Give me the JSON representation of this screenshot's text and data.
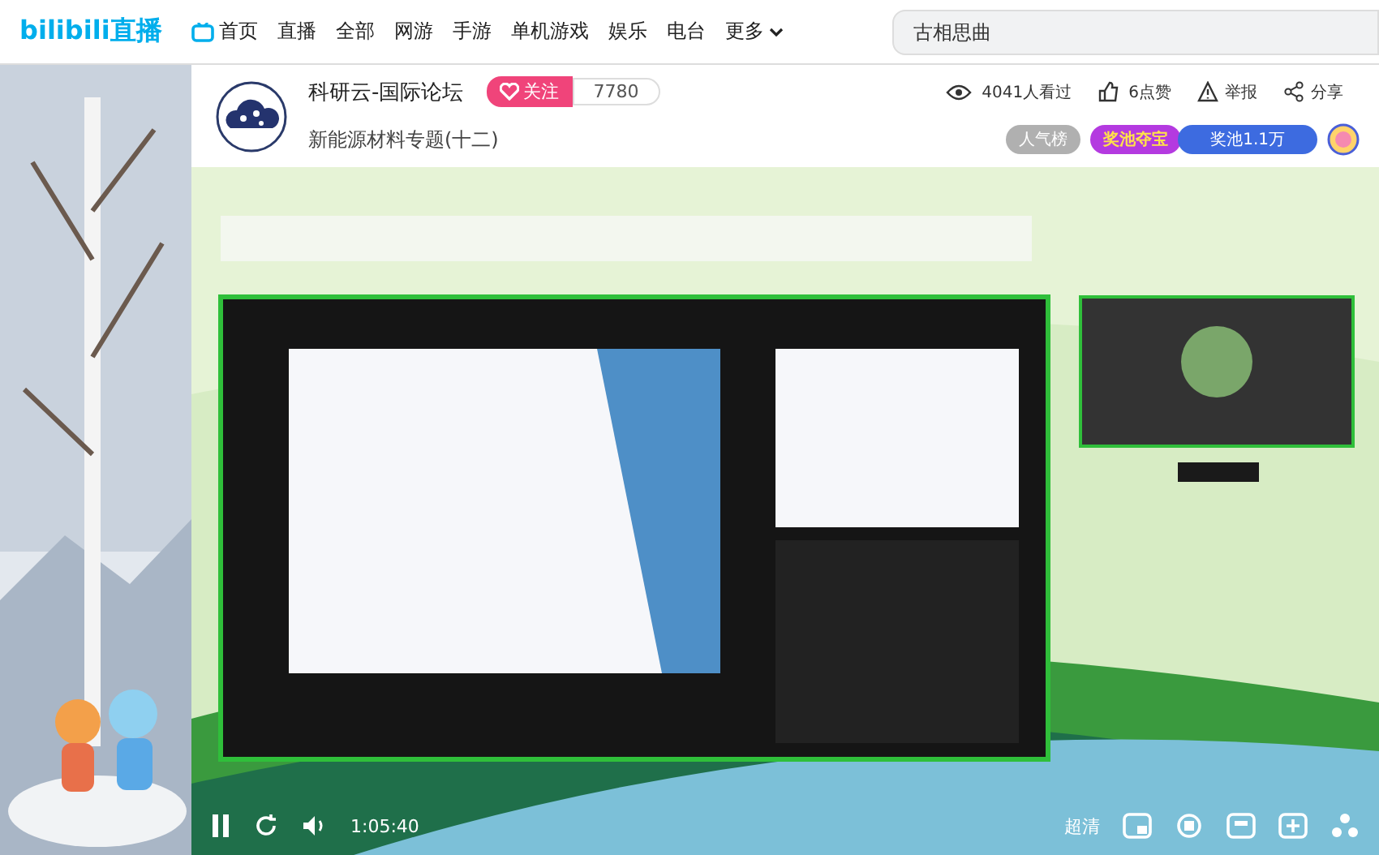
{
  "nav": {
    "logo": "bilibili直播",
    "items": [
      {
        "label": "首页",
        "kind": "home"
      },
      {
        "label": "直播",
        "kind": "text"
      },
      {
        "label": "全部",
        "kind": "text"
      },
      {
        "label": "网游",
        "kind": "text"
      },
      {
        "label": "手游",
        "kind": "text"
      },
      {
        "label": "单机游戏",
        "kind": "text"
      },
      {
        "label": "娱乐",
        "kind": "text"
      },
      {
        "label": "电台",
        "kind": "text"
      },
      {
        "label": "更多",
        "kind": "more"
      }
    ],
    "search": {
      "placeholder": "古相思曲"
    }
  },
  "room": {
    "name": "科研云-国际论坛",
    "follow": "关注",
    "followers": "7780",
    "title": "新能源材料专题(十二)",
    "views": "4041人看过",
    "likes": "6点赞",
    "report": "举报",
    "share": "分享",
    "badges": [
      {
        "label": "人气榜",
        "kind": "grey"
      },
      {
        "label": "奖池夺宝",
        "kind": "purple"
      },
      {
        "label": "奖池1.1万",
        "kind": "blue"
      }
    ]
  },
  "player": {
    "time": "1:05:40",
    "quality": "超清"
  }
}
